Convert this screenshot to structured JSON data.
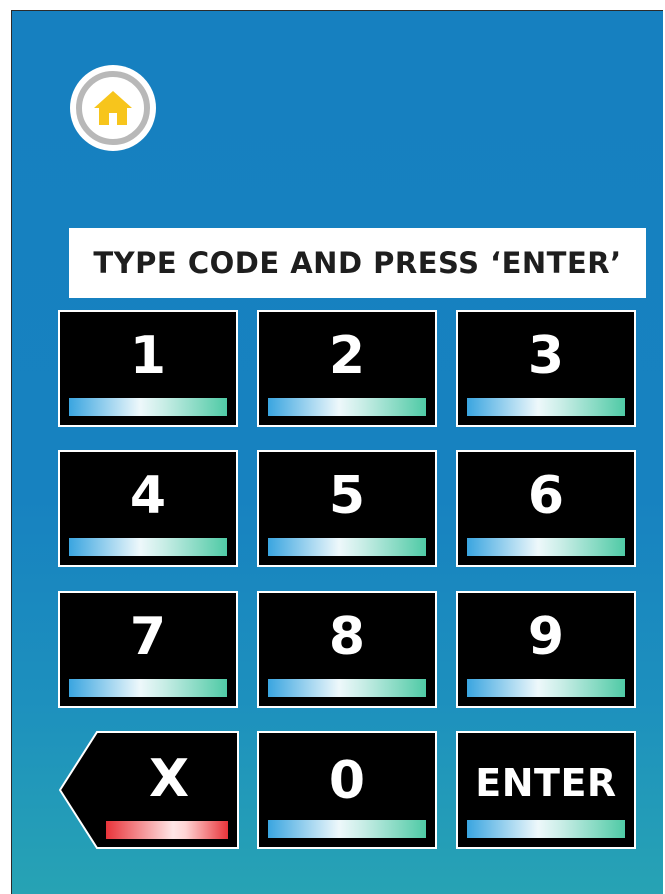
{
  "home": {
    "icon": "home-icon",
    "icon_color": "#f7c51c"
  },
  "banner": {
    "text": "TYPE CODE AND PRESS ‘ENTER’"
  },
  "keypad": {
    "keys": [
      "1",
      "2",
      "3",
      "4",
      "5",
      "6",
      "7",
      "8",
      "9"
    ],
    "clear_label": "X",
    "zero_label": "0",
    "enter_label": "ENTER"
  },
  "colors": {
    "background_top": "#1680c0",
    "background_bottom": "#27a3b4",
    "key_background": "#000000",
    "bar_blue_green": "#4fcaa5",
    "bar_red": "#e8343a"
  }
}
